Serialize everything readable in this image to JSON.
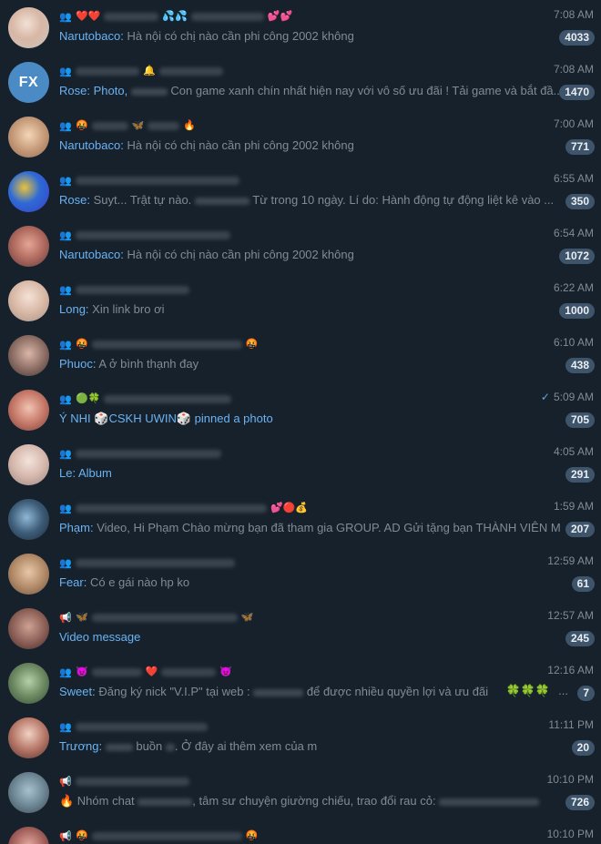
{
  "chats": [
    {
      "title_emojis": "❤️❤️",
      "title_emojis2": "💦💦",
      "title_emojis3": "💕💕",
      "time": "7:08 AM",
      "sender": "Narutobaco",
      "sender_sep": ": ",
      "message": "Hà nội có chị nào cần phi công 2002 không",
      "badge": "4033"
    },
    {
      "avatar_initials": "FX",
      "title_emojis": "🔔",
      "time": "7:08 AM",
      "sender": "Rose",
      "sender_sep": ": ",
      "message_prefix": "Photo, ",
      "message": "Con game xanh chín nhất hiện nay với vô số ưu đãi !  Tải game và bắt đầ...",
      "badge": "1470"
    },
    {
      "title_emojis": "🤬",
      "title_emojis2": "🦋",
      "title_emojis3": "🔥",
      "time": "7:00 AM",
      "sender": "Narutobaco",
      "sender_sep": ": ",
      "message": "Hà nội có chị nào cần phi công 2002 không",
      "badge": "771"
    },
    {
      "time": "6:55 AM",
      "sender": "Rose",
      "sender_sep": ": ",
      "message_prefix": "Suyt... Trật tự nào. ",
      "message": "Từ trong 10 ngày. Lí do: Hành động tự động liệt kê vào ...",
      "badge": "350"
    },
    {
      "time": "6:54 AM",
      "sender": "Narutobaco",
      "sender_sep": ": ",
      "message": "Hà nội có chị nào cần phi công 2002 không",
      "badge": "1072"
    },
    {
      "time": "6:22 AM",
      "sender": "Long",
      "sender_sep": ": ",
      "message": "Xin link bro ơi",
      "badge": "1000"
    },
    {
      "title_emojis": "🤬",
      "title_emojis3": "🤬",
      "time": "6:10 AM",
      "sender": "Phuoc",
      "sender_sep": ": ",
      "message": "A ở bình thạnh đay",
      "badge": "438"
    },
    {
      "title_emojis": "🟢🍀",
      "time": "5:09 AM",
      "tick": "✓",
      "sender": "Ý NHI 🎲CSKH UWIN🎲",
      "sender_sep": " ",
      "message_blue": "pinned a photo",
      "badge": "705"
    },
    {
      "time": "4:05 AM",
      "sender": "Le",
      "sender_sep": ": ",
      "message_blue": "Album",
      "badge": "291"
    },
    {
      "title_emojis3": "💕🔴💰",
      "time": "1:59 AM",
      "sender": "Phạm",
      "sender_sep": ": ",
      "message": "Video, Hi Phạm Chào mừng bạn đã tham gia GROUP. AD Gửi tặng bạn THÀNH VIÊN MỚI...",
      "badge": "207"
    },
    {
      "time": "12:59 AM",
      "sender": "Fear",
      "sender_sep": ": ",
      "message": "Có e gái nào hp ko",
      "badge": "61"
    },
    {
      "title_emojis": "🦋",
      "title_emojis3": "🦋",
      "time": "12:57 AM",
      "message_blue": "Video message",
      "badge": "245"
    },
    {
      "title_emojis": "😈",
      "title_emojis2": "❤️",
      "title_emojis3": "😈",
      "time": "12:16 AM",
      "sender": "Sweet",
      "sender_sep": ": ",
      "message": "Đăng ký nick \"V.I.P\" tại web : ",
      "message_suffix": " để được nhiều quyền lợi và ưu đãi",
      "clover": "🍀🍀🍀",
      "ellipsis": "...",
      "badge": "7"
    },
    {
      "time": "11:11 PM",
      "sender": "Trương",
      "sender_sep": ": ",
      "message_prefix": "",
      "message": "buồn ",
      "message_suffix": ". Ở đây ai thêm xem của m",
      "badge": "20"
    },
    {
      "time": "10:10 PM",
      "message_prefix": "🔥 Nhóm chat ",
      "message": ", tâm sư chuyện giường chiếu, trao đổi rau cỏ:  ",
      "badge": "726"
    },
    {
      "title_emojis": "🤬",
      "title_emojis3": "🤬",
      "time": "10:10 PM"
    }
  ],
  "colors": {
    "background": "#17212b",
    "sender": "#6ab3f3",
    "time": "#7f8b96",
    "badge": "#3e546a",
    "fx_avatar": "#4b8bc5"
  },
  "icons": {
    "group": "group-icon",
    "channel": "megaphone-icon",
    "read": "check-icon"
  }
}
